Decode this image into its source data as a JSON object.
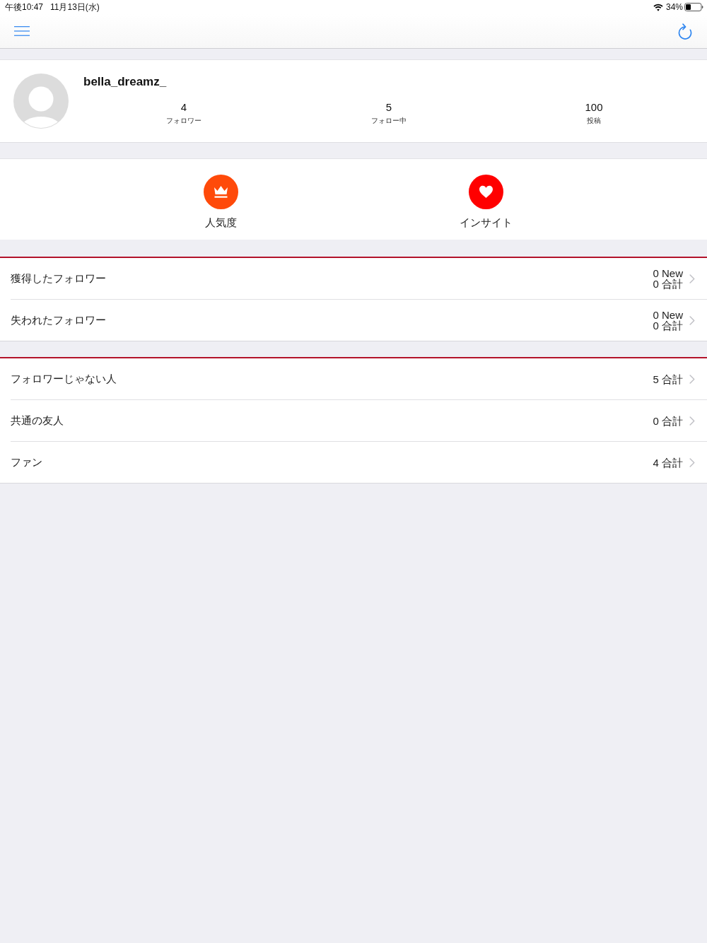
{
  "status_bar": {
    "time": "午後10:47",
    "date": "11月13日(水)",
    "battery": "34%"
  },
  "profile": {
    "username": "bella_dreamz_",
    "stats": [
      {
        "value": "4",
        "label": "フォロワー"
      },
      {
        "value": "5",
        "label": "フォロー中"
      },
      {
        "value": "100",
        "label": "投稿"
      }
    ]
  },
  "features": [
    {
      "kind": "crown",
      "label": "人気度",
      "color": "#ff4a0a"
    },
    {
      "kind": "heart",
      "label": "インサイト",
      "color": "#ff0000"
    }
  ],
  "sections": [
    {
      "rows": [
        {
          "label": "獲得したフォロワー",
          "new": "0 New",
          "total": "0 合計"
        },
        {
          "label": "失われたフォロワー",
          "new": "0 New",
          "total": "0 合計"
        }
      ]
    },
    {
      "rows": [
        {
          "label": "フォロワーじゃない人",
          "total": "5 合計"
        },
        {
          "label": "共通の友人",
          "total": "0 合計"
        },
        {
          "label": "ファン",
          "total": "4 合計"
        }
      ]
    }
  ]
}
